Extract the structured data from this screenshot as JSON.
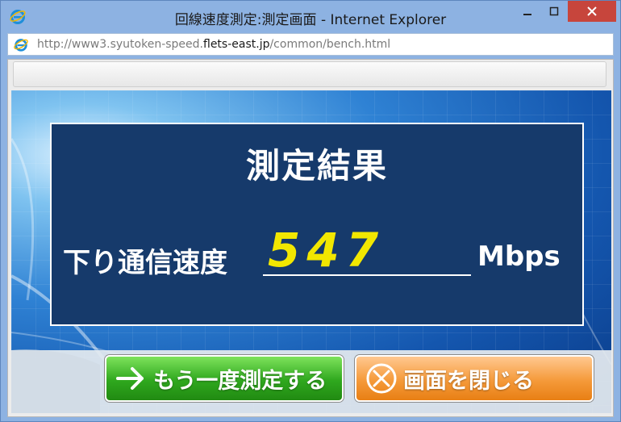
{
  "window": {
    "title": "回線速度測定:測定画面 - Internet Explorer",
    "min_icon": "minimize-icon",
    "max_icon": "maximize-icon",
    "close_icon": "close-icon"
  },
  "address": {
    "prefix": "http://www3.syutoken-speed.",
    "host": "flets-east.jp",
    "path": "/common/bench.html"
  },
  "result": {
    "title": "測定結果",
    "speed_label": "下り通信速度",
    "speed_value": "547",
    "speed_unit": "Mbps"
  },
  "buttons": {
    "measure_again": "もう一度測定する",
    "close_screen": "画面を閉じる",
    "measure_again_icon": "arrow-right-icon",
    "close_screen_icon": "circle-x-icon"
  },
  "colors": {
    "panel_bg": "#163a6b",
    "speed_value": "#f2e700",
    "close_button": "#c7453c",
    "green_button": "#2fa81e",
    "orange_button": "#f59a3a"
  }
}
